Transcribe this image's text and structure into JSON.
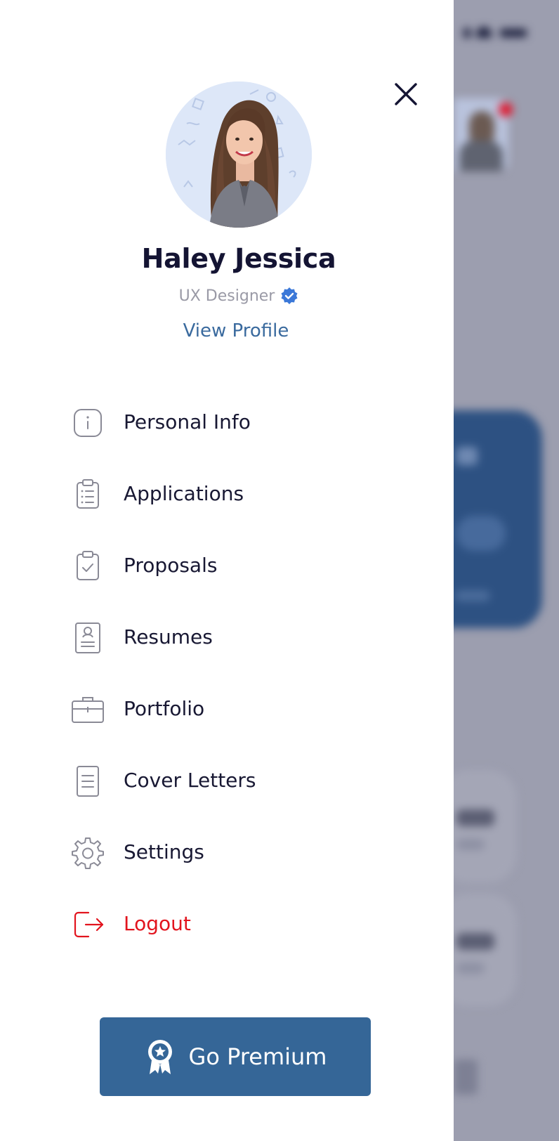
{
  "profile": {
    "name": "Haley Jessica",
    "role": "UX Designer",
    "view_profile_label": "View Profile",
    "verified_icon": "verified-badge-icon"
  },
  "menu": {
    "items": [
      {
        "label": "Personal Info",
        "icon": "info-icon"
      },
      {
        "label": "Applications",
        "icon": "clipboard-list-icon"
      },
      {
        "label": "Proposals",
        "icon": "clipboard-check-icon"
      },
      {
        "label": "Resumes",
        "icon": "resume-icon"
      },
      {
        "label": "Portfolio",
        "icon": "briefcase-icon"
      },
      {
        "label": "Cover Letters",
        "icon": "document-icon"
      },
      {
        "label": "Settings",
        "icon": "gear-icon"
      },
      {
        "label": "Logout",
        "icon": "logout-icon"
      }
    ]
  },
  "premium": {
    "label": "Go Premium",
    "icon": "award-badge-icon"
  },
  "colors": {
    "primary": "#356697",
    "link": "#3a6a9e",
    "danger": "#e2141e",
    "text": "#141433",
    "muted": "#9a9aa6",
    "overlay": "#9c9eaf"
  }
}
